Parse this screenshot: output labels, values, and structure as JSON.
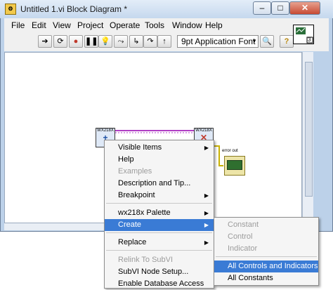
{
  "window": {
    "title": "Untitled 1.vi Block Diagram *",
    "icon": "labview-vi-icon",
    "minimize": "–",
    "maximize": "□",
    "close": "✕"
  },
  "menubar": [
    "File",
    "Edit",
    "View",
    "Project",
    "Operate",
    "Tools",
    "Window",
    "Help"
  ],
  "toolbar": {
    "font": "9pt Application Font",
    "buttons": [
      "run-arrow-icon",
      "run-continuous-icon",
      "abort-icon",
      "pause-icon",
      "highlight-execution-icon",
      "retain-wire-values-icon",
      "step-into-icon",
      "step-over-icon",
      "step-out-icon"
    ],
    "search": "search-icon",
    "help": "?",
    "vi_number": "3"
  },
  "diagram": {
    "node_left": "WX218X",
    "node_right": "WX218X",
    "error_out": "error out"
  },
  "context_menu": {
    "items": [
      {
        "label": "Visible Items",
        "submenu": true,
        "enabled": true
      },
      {
        "label": "Help",
        "submenu": false,
        "enabled": true
      },
      {
        "label": "Examples",
        "submenu": false,
        "enabled": false
      },
      {
        "label": "Description and Tip...",
        "submenu": false,
        "enabled": true
      },
      {
        "label": "Breakpoint",
        "submenu": true,
        "enabled": true
      },
      {
        "label": "wx218x Palette",
        "submenu": true,
        "enabled": true
      },
      {
        "label": "Create",
        "submenu": true,
        "enabled": true,
        "highlighted": true
      },
      {
        "label": "Replace",
        "submenu": true,
        "enabled": true
      },
      {
        "label": "Relink To SubVI",
        "submenu": false,
        "enabled": false
      },
      {
        "label": "SubVI Node Setup...",
        "submenu": false,
        "enabled": true
      },
      {
        "label": "Enable Database Access",
        "submenu": false,
        "enabled": true
      }
    ]
  },
  "submenu": {
    "items": [
      {
        "label": "Constant",
        "enabled": false
      },
      {
        "label": "Control",
        "enabled": false
      },
      {
        "label": "Indicator",
        "enabled": false
      },
      {
        "label": "All Controls and Indicators",
        "enabled": true,
        "highlighted": true
      },
      {
        "label": "All Constants",
        "enabled": true
      }
    ]
  },
  "colors": {
    "highlight": "#3a7bd5",
    "wire": "#b03ec4",
    "error_wire": "#c9b100"
  }
}
